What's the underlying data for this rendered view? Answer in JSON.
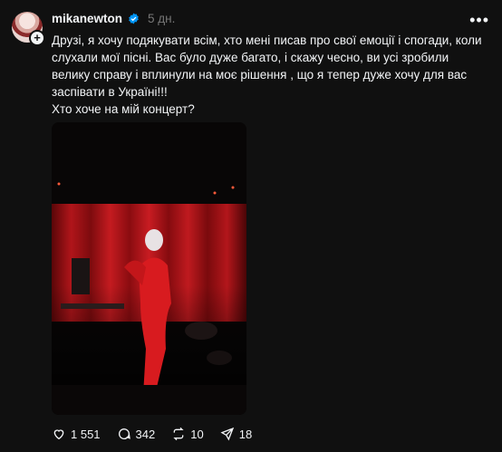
{
  "post": {
    "username": "mikanewton",
    "time": "5 дн.",
    "text": "Друзі, я хочу подякувати всім, хто мені писав про свої емоції і спогади, коли слухали мої пісні. Вас було дуже багато, і скажу чесно, ви усі зробили велику справу і вплинули на моє рішення , що я тепер дуже хочу для вас заспівати в Україні!!!\nХто хоче на мій концерт?",
    "more_icon": "•••"
  },
  "actions": {
    "likes": "1 551",
    "comments": "342",
    "reposts": "10",
    "shares": "18"
  },
  "colors": {
    "background": "#101010",
    "text": "#f3f5f7",
    "muted": "#777777",
    "verified": "#0095f6",
    "curtain": "#b0151a"
  }
}
